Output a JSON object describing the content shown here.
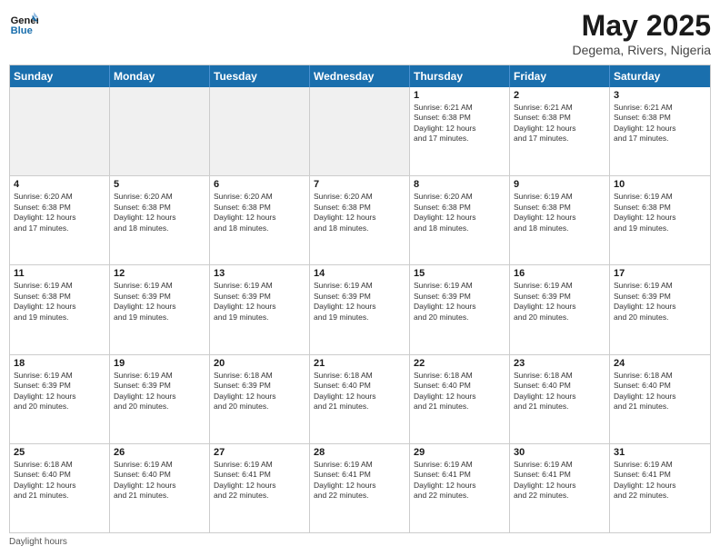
{
  "header": {
    "logo_general": "General",
    "logo_blue": "Blue",
    "title": "May 2025",
    "subtitle": "Degema, Rivers, Nigeria"
  },
  "calendar": {
    "days_of_week": [
      "Sunday",
      "Monday",
      "Tuesday",
      "Wednesday",
      "Thursday",
      "Friday",
      "Saturday"
    ],
    "weeks": [
      [
        {
          "day": "",
          "info": "",
          "shaded": true
        },
        {
          "day": "",
          "info": "",
          "shaded": true
        },
        {
          "day": "",
          "info": "",
          "shaded": true
        },
        {
          "day": "",
          "info": "",
          "shaded": true
        },
        {
          "day": "1",
          "info": "Sunrise: 6:21 AM\nSunset: 6:38 PM\nDaylight: 12 hours\nand 17 minutes.",
          "shaded": false
        },
        {
          "day": "2",
          "info": "Sunrise: 6:21 AM\nSunset: 6:38 PM\nDaylight: 12 hours\nand 17 minutes.",
          "shaded": false
        },
        {
          "day": "3",
          "info": "Sunrise: 6:21 AM\nSunset: 6:38 PM\nDaylight: 12 hours\nand 17 minutes.",
          "shaded": false
        }
      ],
      [
        {
          "day": "4",
          "info": "Sunrise: 6:20 AM\nSunset: 6:38 PM\nDaylight: 12 hours\nand 17 minutes.",
          "shaded": false
        },
        {
          "day": "5",
          "info": "Sunrise: 6:20 AM\nSunset: 6:38 PM\nDaylight: 12 hours\nand 18 minutes.",
          "shaded": false
        },
        {
          "day": "6",
          "info": "Sunrise: 6:20 AM\nSunset: 6:38 PM\nDaylight: 12 hours\nand 18 minutes.",
          "shaded": false
        },
        {
          "day": "7",
          "info": "Sunrise: 6:20 AM\nSunset: 6:38 PM\nDaylight: 12 hours\nand 18 minutes.",
          "shaded": false
        },
        {
          "day": "8",
          "info": "Sunrise: 6:20 AM\nSunset: 6:38 PM\nDaylight: 12 hours\nand 18 minutes.",
          "shaded": false
        },
        {
          "day": "9",
          "info": "Sunrise: 6:19 AM\nSunset: 6:38 PM\nDaylight: 12 hours\nand 18 minutes.",
          "shaded": false
        },
        {
          "day": "10",
          "info": "Sunrise: 6:19 AM\nSunset: 6:38 PM\nDaylight: 12 hours\nand 19 minutes.",
          "shaded": false
        }
      ],
      [
        {
          "day": "11",
          "info": "Sunrise: 6:19 AM\nSunset: 6:38 PM\nDaylight: 12 hours\nand 19 minutes.",
          "shaded": false
        },
        {
          "day": "12",
          "info": "Sunrise: 6:19 AM\nSunset: 6:39 PM\nDaylight: 12 hours\nand 19 minutes.",
          "shaded": false
        },
        {
          "day": "13",
          "info": "Sunrise: 6:19 AM\nSunset: 6:39 PM\nDaylight: 12 hours\nand 19 minutes.",
          "shaded": false
        },
        {
          "day": "14",
          "info": "Sunrise: 6:19 AM\nSunset: 6:39 PM\nDaylight: 12 hours\nand 19 minutes.",
          "shaded": false
        },
        {
          "day": "15",
          "info": "Sunrise: 6:19 AM\nSunset: 6:39 PM\nDaylight: 12 hours\nand 20 minutes.",
          "shaded": false
        },
        {
          "day": "16",
          "info": "Sunrise: 6:19 AM\nSunset: 6:39 PM\nDaylight: 12 hours\nand 20 minutes.",
          "shaded": false
        },
        {
          "day": "17",
          "info": "Sunrise: 6:19 AM\nSunset: 6:39 PM\nDaylight: 12 hours\nand 20 minutes.",
          "shaded": false
        }
      ],
      [
        {
          "day": "18",
          "info": "Sunrise: 6:19 AM\nSunset: 6:39 PM\nDaylight: 12 hours\nand 20 minutes.",
          "shaded": false
        },
        {
          "day": "19",
          "info": "Sunrise: 6:19 AM\nSunset: 6:39 PM\nDaylight: 12 hours\nand 20 minutes.",
          "shaded": false
        },
        {
          "day": "20",
          "info": "Sunrise: 6:18 AM\nSunset: 6:39 PM\nDaylight: 12 hours\nand 20 minutes.",
          "shaded": false
        },
        {
          "day": "21",
          "info": "Sunrise: 6:18 AM\nSunset: 6:40 PM\nDaylight: 12 hours\nand 21 minutes.",
          "shaded": false
        },
        {
          "day": "22",
          "info": "Sunrise: 6:18 AM\nSunset: 6:40 PM\nDaylight: 12 hours\nand 21 minutes.",
          "shaded": false
        },
        {
          "day": "23",
          "info": "Sunrise: 6:18 AM\nSunset: 6:40 PM\nDaylight: 12 hours\nand 21 minutes.",
          "shaded": false
        },
        {
          "day": "24",
          "info": "Sunrise: 6:18 AM\nSunset: 6:40 PM\nDaylight: 12 hours\nand 21 minutes.",
          "shaded": false
        }
      ],
      [
        {
          "day": "25",
          "info": "Sunrise: 6:18 AM\nSunset: 6:40 PM\nDaylight: 12 hours\nand 21 minutes.",
          "shaded": false
        },
        {
          "day": "26",
          "info": "Sunrise: 6:19 AM\nSunset: 6:40 PM\nDaylight: 12 hours\nand 21 minutes.",
          "shaded": false
        },
        {
          "day": "27",
          "info": "Sunrise: 6:19 AM\nSunset: 6:41 PM\nDaylight: 12 hours\nand 22 minutes.",
          "shaded": false
        },
        {
          "day": "28",
          "info": "Sunrise: 6:19 AM\nSunset: 6:41 PM\nDaylight: 12 hours\nand 22 minutes.",
          "shaded": false
        },
        {
          "day": "29",
          "info": "Sunrise: 6:19 AM\nSunset: 6:41 PM\nDaylight: 12 hours\nand 22 minutes.",
          "shaded": false
        },
        {
          "day": "30",
          "info": "Sunrise: 6:19 AM\nSunset: 6:41 PM\nDaylight: 12 hours\nand 22 minutes.",
          "shaded": false
        },
        {
          "day": "31",
          "info": "Sunrise: 6:19 AM\nSunset: 6:41 PM\nDaylight: 12 hours\nand 22 minutes.",
          "shaded": false
        }
      ]
    ]
  },
  "footer": {
    "note": "Daylight hours"
  }
}
